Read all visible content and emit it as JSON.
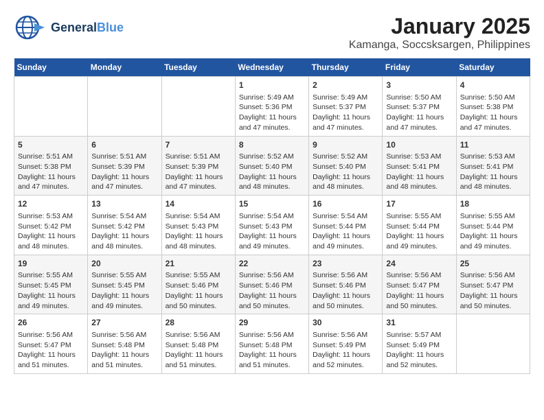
{
  "logo": {
    "line1": "General",
    "line2": "Blue"
  },
  "title": "January 2025",
  "subtitle": "Kamanga, Soccsksargen, Philippines",
  "days_of_week": [
    "Sunday",
    "Monday",
    "Tuesday",
    "Wednesday",
    "Thursday",
    "Friday",
    "Saturday"
  ],
  "weeks": [
    [
      {
        "day": "",
        "info": ""
      },
      {
        "day": "",
        "info": ""
      },
      {
        "day": "",
        "info": ""
      },
      {
        "day": "1",
        "info": "Sunrise: 5:49 AM\nSunset: 5:36 PM\nDaylight: 11 hours and 47 minutes."
      },
      {
        "day": "2",
        "info": "Sunrise: 5:49 AM\nSunset: 5:37 PM\nDaylight: 11 hours and 47 minutes."
      },
      {
        "day": "3",
        "info": "Sunrise: 5:50 AM\nSunset: 5:37 PM\nDaylight: 11 hours and 47 minutes."
      },
      {
        "day": "4",
        "info": "Sunrise: 5:50 AM\nSunset: 5:38 PM\nDaylight: 11 hours and 47 minutes."
      }
    ],
    [
      {
        "day": "5",
        "info": "Sunrise: 5:51 AM\nSunset: 5:38 PM\nDaylight: 11 hours and 47 minutes."
      },
      {
        "day": "6",
        "info": "Sunrise: 5:51 AM\nSunset: 5:39 PM\nDaylight: 11 hours and 47 minutes."
      },
      {
        "day": "7",
        "info": "Sunrise: 5:51 AM\nSunset: 5:39 PM\nDaylight: 11 hours and 47 minutes."
      },
      {
        "day": "8",
        "info": "Sunrise: 5:52 AM\nSunset: 5:40 PM\nDaylight: 11 hours and 48 minutes."
      },
      {
        "day": "9",
        "info": "Sunrise: 5:52 AM\nSunset: 5:40 PM\nDaylight: 11 hours and 48 minutes."
      },
      {
        "day": "10",
        "info": "Sunrise: 5:53 AM\nSunset: 5:41 PM\nDaylight: 11 hours and 48 minutes."
      },
      {
        "day": "11",
        "info": "Sunrise: 5:53 AM\nSunset: 5:41 PM\nDaylight: 11 hours and 48 minutes."
      }
    ],
    [
      {
        "day": "12",
        "info": "Sunrise: 5:53 AM\nSunset: 5:42 PM\nDaylight: 11 hours and 48 minutes."
      },
      {
        "day": "13",
        "info": "Sunrise: 5:54 AM\nSunset: 5:42 PM\nDaylight: 11 hours and 48 minutes."
      },
      {
        "day": "14",
        "info": "Sunrise: 5:54 AM\nSunset: 5:43 PM\nDaylight: 11 hours and 48 minutes."
      },
      {
        "day": "15",
        "info": "Sunrise: 5:54 AM\nSunset: 5:43 PM\nDaylight: 11 hours and 49 minutes."
      },
      {
        "day": "16",
        "info": "Sunrise: 5:54 AM\nSunset: 5:44 PM\nDaylight: 11 hours and 49 minutes."
      },
      {
        "day": "17",
        "info": "Sunrise: 5:55 AM\nSunset: 5:44 PM\nDaylight: 11 hours and 49 minutes."
      },
      {
        "day": "18",
        "info": "Sunrise: 5:55 AM\nSunset: 5:44 PM\nDaylight: 11 hours and 49 minutes."
      }
    ],
    [
      {
        "day": "19",
        "info": "Sunrise: 5:55 AM\nSunset: 5:45 PM\nDaylight: 11 hours and 49 minutes."
      },
      {
        "day": "20",
        "info": "Sunrise: 5:55 AM\nSunset: 5:45 PM\nDaylight: 11 hours and 49 minutes."
      },
      {
        "day": "21",
        "info": "Sunrise: 5:55 AM\nSunset: 5:46 PM\nDaylight: 11 hours and 50 minutes."
      },
      {
        "day": "22",
        "info": "Sunrise: 5:56 AM\nSunset: 5:46 PM\nDaylight: 11 hours and 50 minutes."
      },
      {
        "day": "23",
        "info": "Sunrise: 5:56 AM\nSunset: 5:46 PM\nDaylight: 11 hours and 50 minutes."
      },
      {
        "day": "24",
        "info": "Sunrise: 5:56 AM\nSunset: 5:47 PM\nDaylight: 11 hours and 50 minutes."
      },
      {
        "day": "25",
        "info": "Sunrise: 5:56 AM\nSunset: 5:47 PM\nDaylight: 11 hours and 50 minutes."
      }
    ],
    [
      {
        "day": "26",
        "info": "Sunrise: 5:56 AM\nSunset: 5:47 PM\nDaylight: 11 hours and 51 minutes."
      },
      {
        "day": "27",
        "info": "Sunrise: 5:56 AM\nSunset: 5:48 PM\nDaylight: 11 hours and 51 minutes."
      },
      {
        "day": "28",
        "info": "Sunrise: 5:56 AM\nSunset: 5:48 PM\nDaylight: 11 hours and 51 minutes."
      },
      {
        "day": "29",
        "info": "Sunrise: 5:56 AM\nSunset: 5:48 PM\nDaylight: 11 hours and 51 minutes."
      },
      {
        "day": "30",
        "info": "Sunrise: 5:56 AM\nSunset: 5:49 PM\nDaylight: 11 hours and 52 minutes."
      },
      {
        "day": "31",
        "info": "Sunrise: 5:57 AM\nSunset: 5:49 PM\nDaylight: 11 hours and 52 minutes."
      },
      {
        "day": "",
        "info": ""
      }
    ]
  ]
}
